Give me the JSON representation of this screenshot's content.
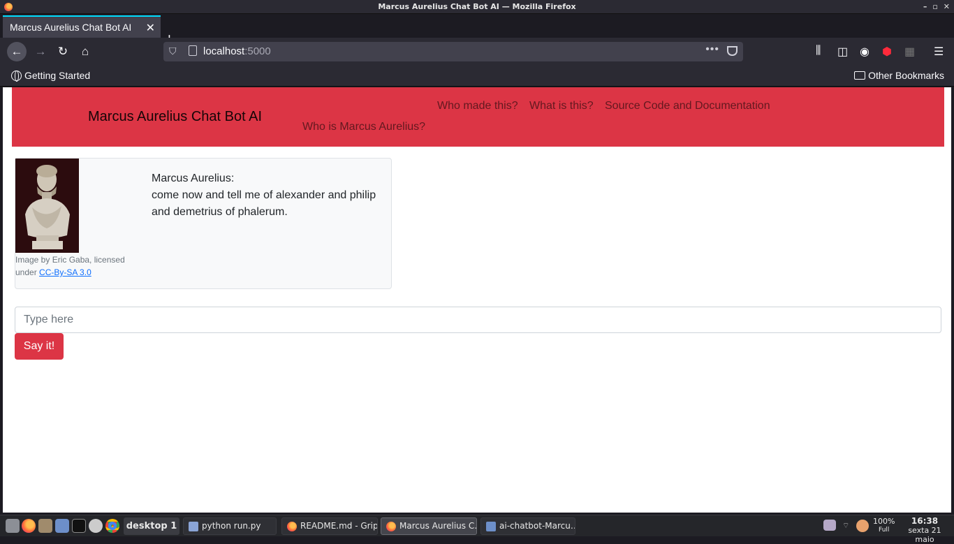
{
  "window": {
    "title": "Marcus Aurelius Chat Bot AI — Mozilla Firefox",
    "controls": [
      "–",
      "▫",
      "✕"
    ]
  },
  "browser": {
    "tab_title": "Marcus Aurelius Chat Bot AI",
    "url_host": "localhost",
    "url_port": ":5000",
    "bookmarks": {
      "getting_started": "Getting Started",
      "other": "Other Bookmarks"
    }
  },
  "page": {
    "brand": "Marcus Aurelius Chat Bot AI",
    "nav": {
      "who_made": "Who made this?",
      "what_is": "What is this?",
      "source": "Source Code and Documentation",
      "who_is": "Who is Marcus Aurelius?"
    },
    "chat": {
      "image_credit_prefix": "Image by Eric Gaba, licensed under",
      "license_link": "CC-By-SA 3.0",
      "speaker": "Marcus Aurelius:",
      "message": "come now and tell me of alexander and philip and demetrius of phalerum."
    },
    "input": {
      "placeholder": "Type here",
      "value": ""
    },
    "submit_label": "Say it!"
  },
  "taskbar": {
    "desktop": "desktop 1",
    "tasks": [
      "python run.py",
      "README.md - Grip…",
      "Marcus Aurelius C…",
      "ai-chatbot-Marcu…"
    ],
    "battery_percent": "100%",
    "battery_state": "Full",
    "time": "16:38",
    "date": "sexta 21 maio"
  },
  "colors": {
    "brand_red": "#dc3545",
    "firefox_accent": "#00ddff"
  }
}
